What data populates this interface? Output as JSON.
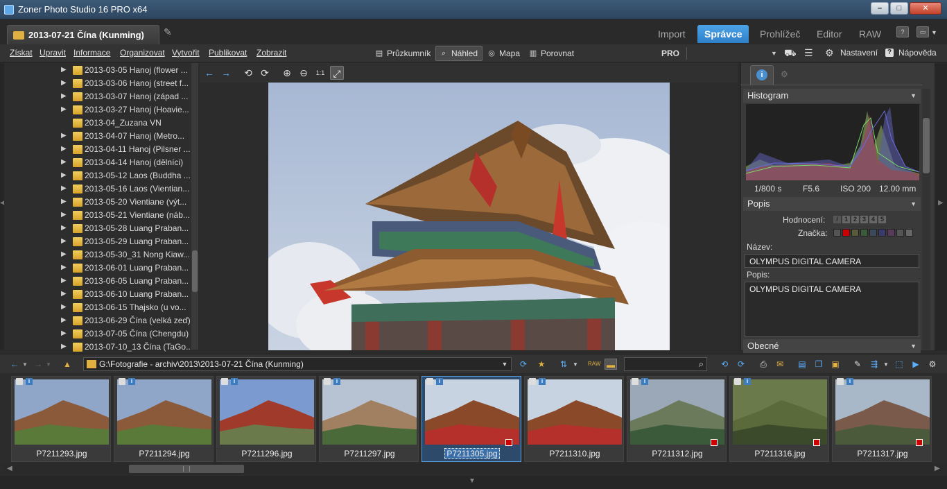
{
  "window": {
    "title": "Zoner Photo Studio 16 PRO x64"
  },
  "document_tab": {
    "label": "2013-07-21 Čína (Kunming)"
  },
  "modules": [
    {
      "label": "Import",
      "active": false
    },
    {
      "label": "Správce",
      "active": true
    },
    {
      "label": "Prohlížeč",
      "active": false
    },
    {
      "label": "Editor",
      "active": false
    },
    {
      "label": "RAW",
      "active": false
    }
  ],
  "menu": [
    "Získat",
    "Upravit",
    "Informace",
    "Organizovat",
    "Vytvořit",
    "Publikovat",
    "Zobrazit"
  ],
  "view_modes": [
    {
      "label": "Průzkumník",
      "icon": "explorer-icon",
      "active": false
    },
    {
      "label": "Náhled",
      "icon": "magnifier-icon",
      "active": true
    },
    {
      "label": "Mapa",
      "icon": "map-icon",
      "active": false
    },
    {
      "label": "Porovnat",
      "icon": "compare-icon",
      "active": false
    }
  ],
  "pro_label": "PRO",
  "right_menu": {
    "settings": "Nastavení",
    "help": "Nápověda"
  },
  "folders": [
    "2013-03-05 Hanoj (flower ...",
    "2013-03-06 Hanoj (street f...",
    "2013-03-07 Hanoj (západ ...",
    "2013-03-27 Hanoj (Hoavie...",
    "2013-04_Zuzana VN",
    "2013-04-07 Hanoj (Metro...",
    "2013-04-11 Hanoj (Pilsner ...",
    "2013-04-14 Hanoj (dělníci)",
    "2013-05-12 Laos (Buddha ...",
    "2013-05-16 Laos (Vientian...",
    "2013-05-20 Vientiane (výt...",
    "2013-05-21 Vientiane (náb...",
    "2013-05-28 Luang Praban...",
    "2013-05-29 Luang Praban...",
    "2013-05-30_31 Nong Kiaw...",
    "2013-06-01 Luang Praban...",
    "2013-06-05 Luang Praban...",
    "2013-06-10 Luang Praban...",
    "2013-06-15 Thajsko (u vo...",
    "2013-06-29 Čína (velká zeď)",
    "2013-07-05 Čína (Chengdu)",
    "2013-07-10_13 Čína (TaGo..."
  ],
  "info_panel": {
    "histogram_title": "Histogram",
    "exif": {
      "shutter": "1/800 s",
      "aperture": "F5.6",
      "iso": "ISO 200",
      "focal": "12.00 mm"
    },
    "description_title": "Popis",
    "rating_label": "Hodnocení:",
    "rating_values": [
      "1",
      "2",
      "3",
      "4",
      "5"
    ],
    "tag_label": "Značka:",
    "tag_colors": [
      "#cc0000",
      "#5a5a3a",
      "#3a5a3a",
      "#3a4a5a",
      "#3a3a6a",
      "#5a3a5a",
      "#555555",
      "#666666"
    ],
    "name_label": "Název:",
    "name_value": "OLYMPUS DIGITAL CAMERA",
    "desc_label": "Popis:",
    "desc_value": "OLYMPUS DIGITAL CAMERA",
    "general_title": "Obecné"
  },
  "path": {
    "value": "G:\\Fotografie - archiv\\2013\\2013-07-21 Čína (Kunming)"
  },
  "thumbnails": [
    {
      "name": "P7211293.jpg",
      "selected": false,
      "tag": false
    },
    {
      "name": "P7211294.jpg",
      "selected": false,
      "tag": false
    },
    {
      "name": "P7211296.jpg",
      "selected": false,
      "tag": false
    },
    {
      "name": "P7211297.jpg",
      "selected": false,
      "tag": false
    },
    {
      "name": "P7211305.jpg",
      "selected": true,
      "tag": true
    },
    {
      "name": "P7211310.jpg",
      "selected": false,
      "tag": false
    },
    {
      "name": "P7211312.jpg",
      "selected": false,
      "tag": true
    },
    {
      "name": "P7211316.jpg",
      "selected": false,
      "tag": true
    },
    {
      "name": "P7211317.jpg",
      "selected": false,
      "tag": true
    }
  ]
}
